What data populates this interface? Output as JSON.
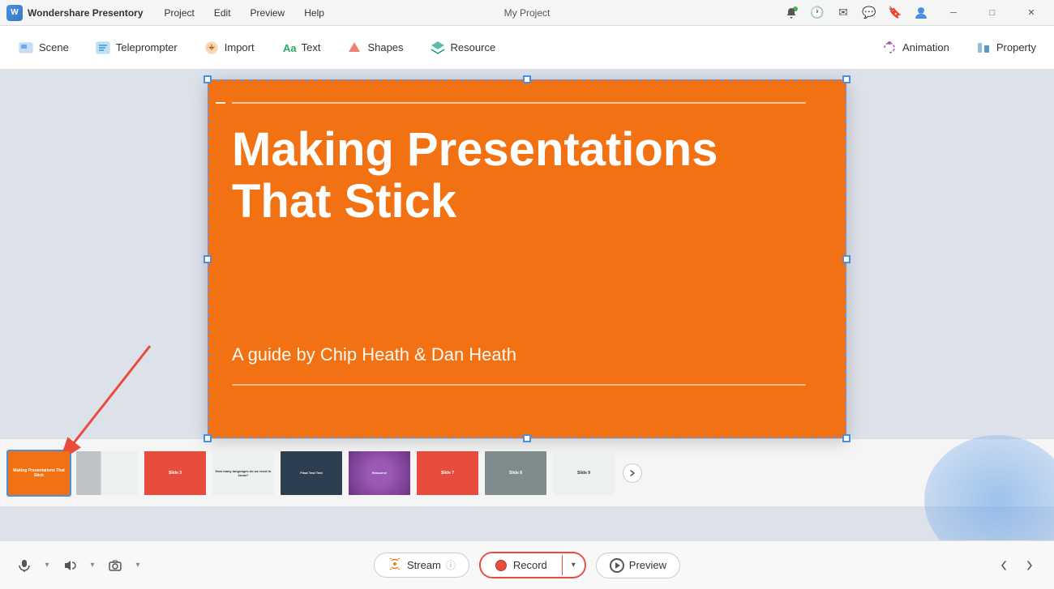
{
  "app": {
    "name": "Wondershare Presentory",
    "title_center": "My Project"
  },
  "menu": {
    "items": [
      "Project",
      "Edit",
      "Preview",
      "Help"
    ]
  },
  "toolbar": {
    "items": [
      {
        "label": "Scene",
        "color": "#4a90e2"
      },
      {
        "label": "Teleprompter",
        "color": "#3498db"
      },
      {
        "label": "Import",
        "color": "#e67e22"
      },
      {
        "label": "Text",
        "color": "#27ae60"
      },
      {
        "label": "Shapes",
        "color": "#e74c3c"
      },
      {
        "label": "Resource",
        "color": "#16a085"
      },
      {
        "label": "Animation",
        "color": "#9b59b6"
      },
      {
        "label": "Property",
        "color": "#2980b9"
      }
    ]
  },
  "slide": {
    "background_color": "#f27213",
    "title": "Making Presentations That Stick",
    "subtitle": "A guide by Chip Heath & Dan Heath"
  },
  "thumbnails": [
    {
      "bg": "#f27213",
      "active": true
    },
    {
      "bg": "#7f8c8d",
      "active": false
    },
    {
      "bg": "#e74c3c",
      "active": false
    },
    {
      "bg": "#95a5a6",
      "active": false
    },
    {
      "bg": "#2c3e50",
      "active": false
    },
    {
      "bg": "#8e44ad",
      "active": false
    },
    {
      "bg": "#e74c3c",
      "active": false
    },
    {
      "bg": "#7f8c8d",
      "active": false
    },
    {
      "bg": "#ecf0f1",
      "active": false
    }
  ],
  "bottom_bar": {
    "stream_label": "Stream",
    "record_label": "Record",
    "preview_label": "Preview",
    "stream_info_icon": "ⓘ"
  },
  "window_controls": {
    "minimize": "─",
    "maximize": "□",
    "close": "✕"
  }
}
